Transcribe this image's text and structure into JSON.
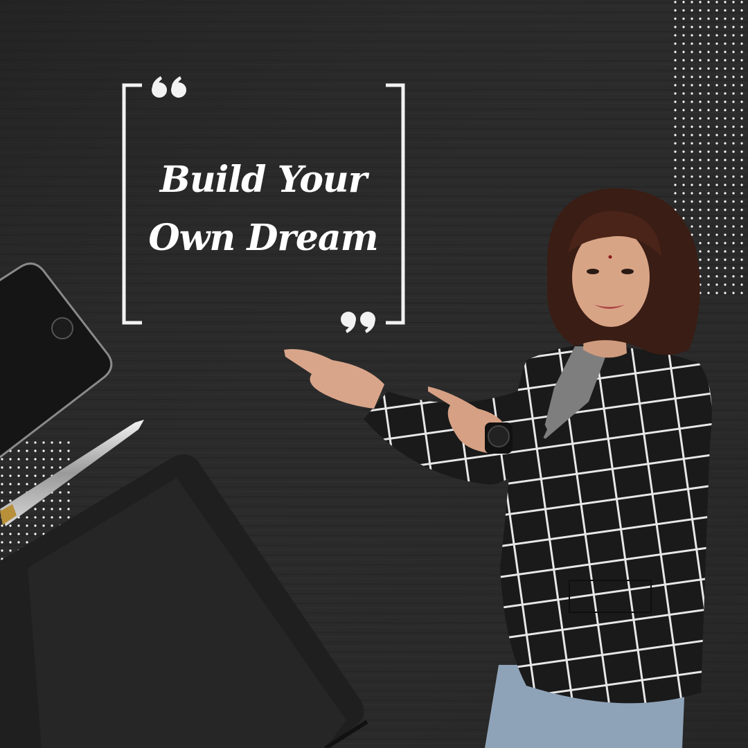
{
  "quote": {
    "line1": "Build Your",
    "line2": "Own Dream"
  },
  "colors": {
    "background": "#2b2b2b",
    "text": "#ffffff",
    "frame": "#f2f2f2",
    "dots": "#ffffff",
    "blazer": "#1a1a1a",
    "blazer_grid": "#e8e8e8"
  },
  "icons": {
    "open_quote": "left-double-quote-icon",
    "close_quote": "right-double-quote-icon"
  }
}
